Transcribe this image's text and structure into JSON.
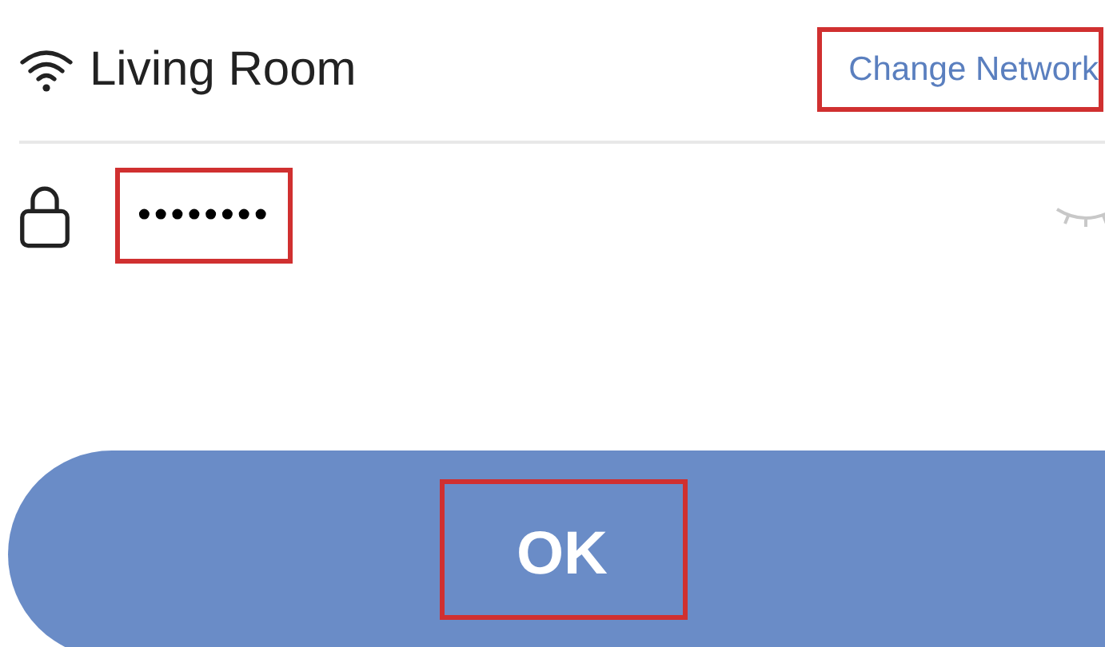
{
  "network": {
    "name": "Living Room",
    "change_link": {
      "label": "Change Network",
      "highlighted": true
    }
  },
  "password": {
    "value": "••••••••",
    "highlighted": true
  },
  "ok_button": {
    "label": "OK",
    "highlighted": true
  }
}
